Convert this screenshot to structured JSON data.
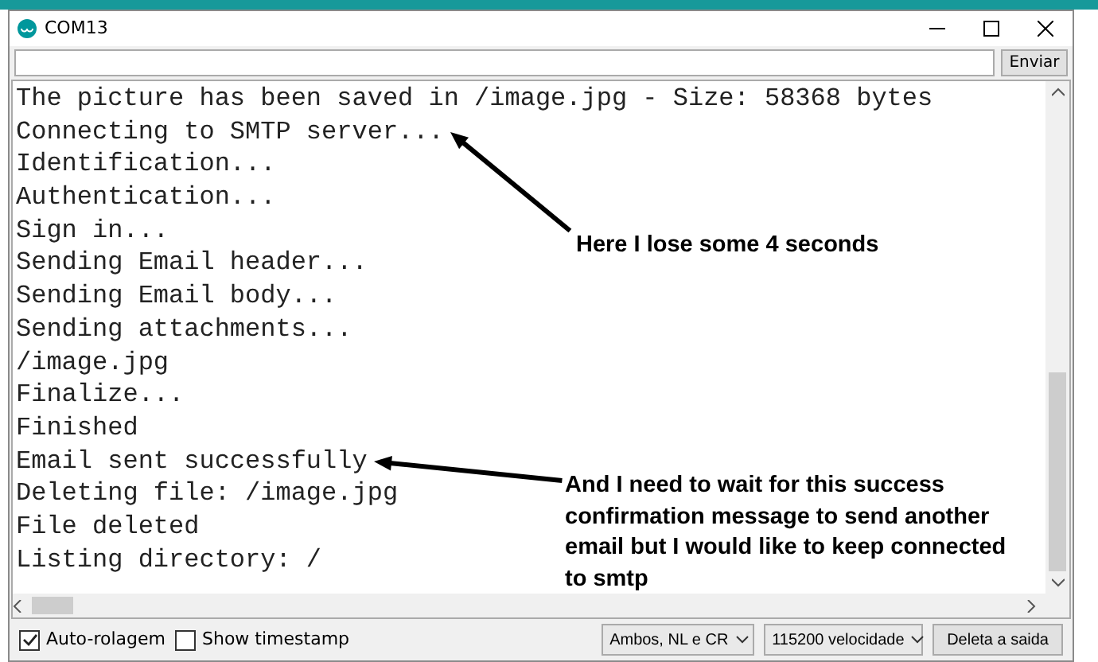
{
  "window": {
    "title": "COM13"
  },
  "send_button": "Enviar",
  "output_lines": [
    "The picture has been saved in /image.jpg - Size: 58368 bytes",
    "Connecting to SMTP server...",
    "Identification...",
    "Authentication...",
    "Sign in...",
    "Sending Email header...",
    "Sending Email body...",
    "Sending attachments...",
    "/image.jpg",
    "Finalize...",
    "Finished",
    "Email sent successfully",
    "Deleting file: /image.jpg",
    "File deleted",
    "Listing directory: /"
  ],
  "annotations": [
    {
      "text": "Here I lose some 4 seconds"
    },
    {
      "text": "And I need to wait for this success confirmation message to send another email but I would like to keep connected to smtp"
    }
  ],
  "footer": {
    "autoscroll": {
      "label": "Auto-rolagem",
      "checked": true
    },
    "timestamp": {
      "label": "Show timestamp",
      "checked": false
    },
    "line_ending": "Ambos, NL e CR",
    "baud": "115200 velocidade",
    "clear_button": "Deleta a saida"
  }
}
